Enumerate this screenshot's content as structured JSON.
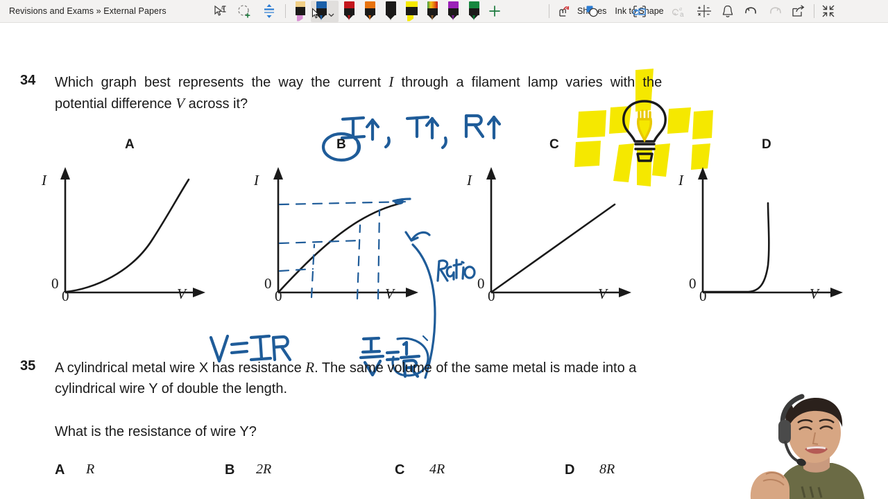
{
  "app": {
    "breadcrumb": "Revisions and Exams » External Papers"
  },
  "toolbar": {
    "tools": [
      {
        "name": "ink-to-text-icon",
        "label": "Ink to Text"
      },
      {
        "name": "lasso-select-icon",
        "label": "Lasso Select"
      },
      {
        "name": "ink-thickness-icon",
        "label": "Ink Thickness"
      }
    ],
    "pens": [
      {
        "name": "highlighter-pink",
        "kind": "highlighter",
        "color": "#d98fd4",
        "cap": "#f0cf87",
        "selected": false
      },
      {
        "name": "pen-blue",
        "kind": "pen",
        "color": "#1b5fa8",
        "cap": "#1b5fa8",
        "selected": true
      },
      {
        "name": "pen-red",
        "kind": "pen",
        "color": "#c3161c",
        "cap": "#c3161c",
        "selected": false
      },
      {
        "name": "pen-orange",
        "kind": "pen",
        "color": "#d4620a",
        "cap": "#e8730d",
        "selected": false
      },
      {
        "name": "pen-black",
        "kind": "pen",
        "color": "#1b1a19",
        "cap": "#1b1a19",
        "selected": false
      },
      {
        "name": "highlighter-yellow",
        "kind": "highlighter",
        "color": "#f5e800",
        "cap": "#f5e800",
        "selected": false
      },
      {
        "name": "pen-rainbow",
        "kind": "pen",
        "color": "#8a5a2b",
        "cap": "#3a9b46",
        "selected": false
      },
      {
        "name": "pen-purple",
        "kind": "pen",
        "color": "#7a1f96",
        "cap": "#9b22b8",
        "selected": false
      },
      {
        "name": "pen-green",
        "kind": "pen",
        "color": "#0a7a33",
        "cap": "#17873f",
        "selected": false
      }
    ],
    "add_pen_label": "+",
    "buttons": [
      {
        "name": "ink-replay-button",
        "label": ""
      },
      {
        "name": "shapes-button",
        "label": "Shapes"
      },
      {
        "name": "ink-to-shape-button",
        "label": "Ink to Shape"
      },
      {
        "name": "ink-to-text-button",
        "label": ""
      },
      {
        "name": "ink-to-math-button",
        "label": ""
      },
      {
        "name": "notifications-button",
        "label": ""
      },
      {
        "name": "undo-button",
        "label": ""
      },
      {
        "name": "redo-button",
        "label": ""
      },
      {
        "name": "share-button",
        "label": ""
      },
      {
        "name": "collapse-ribbon-button",
        "label": ""
      }
    ]
  },
  "questions": [
    {
      "number": "34",
      "line1": "Which graph best represents the way the current I through a filament lamp varies with the",
      "line2": "potential difference V across it?",
      "graphs": [
        {
          "letter": "A",
          "axis_y": "I",
          "axis_x": "V",
          "origin": "0",
          "shape": "concave-up-increasing"
        },
        {
          "letter": "B",
          "axis_y": "I",
          "axis_x": "V",
          "origin": "0",
          "shape": "concave-down-increasing",
          "circled": true
        },
        {
          "letter": "C",
          "axis_y": "I",
          "axis_x": "V",
          "origin": "0",
          "shape": "straight-line"
        },
        {
          "letter": "D",
          "axis_y": "I",
          "axis_x": "V",
          "origin": "0",
          "shape": "flat-then-steep"
        }
      ]
    },
    {
      "number": "35",
      "line1": "A cylindrical metal wire X has resistance R. The same volume of the same metal is made into a",
      "line2": "cylindrical wire Y of double the length.",
      "line3": "What is the resistance of wire Y?",
      "options": [
        {
          "letter": "A",
          "value": "R"
        },
        {
          "letter": "B",
          "value": "2R"
        },
        {
          "letter": "C",
          "value": "4R"
        },
        {
          "letter": "D",
          "value": "8R"
        }
      ]
    }
  ],
  "annotations": {
    "ink_color": "#1f5c99",
    "highlight_color": "#f5e800",
    "top_note": "I↑ , T↑ , R↑",
    "formula_left": "V=IR",
    "formula_right": "I/V = 1/R",
    "ratio_label": "Ratio",
    "circled_answer": "B",
    "doodle": "filament-lamp-with-rays"
  }
}
